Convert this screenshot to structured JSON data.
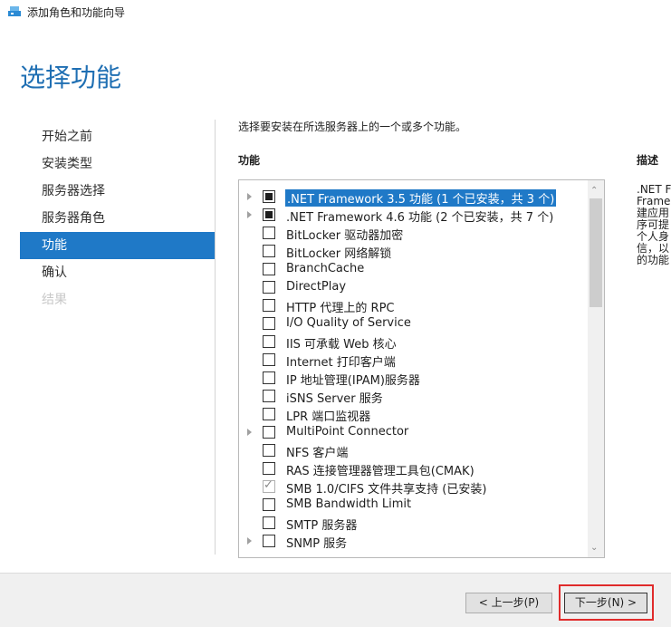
{
  "window": {
    "title": "添加角色和功能向导",
    "icon": "server-manager-icon"
  },
  "page_title": "选择功能",
  "nav": [
    {
      "label": "开始之前",
      "state": "normal"
    },
    {
      "label": "安装类型",
      "state": "normal"
    },
    {
      "label": "服务器选择",
      "state": "normal"
    },
    {
      "label": "服务器角色",
      "state": "normal"
    },
    {
      "label": "功能",
      "state": "active"
    },
    {
      "label": "确认",
      "state": "normal"
    },
    {
      "label": "结果",
      "state": "disabled"
    }
  ],
  "instruction": "选择要安装在所选服务器上的一个或多个功能。",
  "features_label": "功能",
  "description_label": "描述",
  "description_text": ".NET F\nFrame\n建应用\n序可提\n个人身\n信，以\n的功能",
  "features": [
    {
      "label": ".NET Framework 3.5 功能 (1 个已安装，共 3 个)",
      "expandable": true,
      "state": "partial",
      "selected": true
    },
    {
      "label": ".NET Framework 4.6 功能 (2 个已安装，共 7 个)",
      "expandable": true,
      "state": "partial",
      "selected": false
    },
    {
      "label": "BitLocker 驱动器加密",
      "expandable": false,
      "state": "unchecked",
      "selected": false
    },
    {
      "label": "BitLocker 网络解锁",
      "expandable": false,
      "state": "unchecked",
      "selected": false
    },
    {
      "label": "BranchCache",
      "expandable": false,
      "state": "unchecked",
      "selected": false
    },
    {
      "label": "DirectPlay",
      "expandable": false,
      "state": "unchecked",
      "selected": false
    },
    {
      "label": "HTTP 代理上的 RPC",
      "expandable": false,
      "state": "unchecked",
      "selected": false
    },
    {
      "label": "I/O Quality of Service",
      "expandable": false,
      "state": "unchecked",
      "selected": false
    },
    {
      "label": "IIS 可承载 Web 核心",
      "expandable": false,
      "state": "unchecked",
      "selected": false
    },
    {
      "label": "Internet 打印客户端",
      "expandable": false,
      "state": "unchecked",
      "selected": false
    },
    {
      "label": "IP 地址管理(IPAM)服务器",
      "expandable": false,
      "state": "unchecked",
      "selected": false
    },
    {
      "label": "iSNS Server 服务",
      "expandable": false,
      "state": "unchecked",
      "selected": false
    },
    {
      "label": "LPR 端口监视器",
      "expandable": false,
      "state": "unchecked",
      "selected": false
    },
    {
      "label": "MultiPoint Connector",
      "expandable": true,
      "state": "unchecked",
      "selected": false
    },
    {
      "label": "NFS 客户端",
      "expandable": false,
      "state": "unchecked",
      "selected": false
    },
    {
      "label": "RAS 连接管理器管理工具包(CMAK)",
      "expandable": false,
      "state": "unchecked",
      "selected": false
    },
    {
      "label": "SMB 1.0/CIFS 文件共享支持 (已安装)",
      "expandable": false,
      "state": "checked",
      "selected": false
    },
    {
      "label": "SMB Bandwidth Limit",
      "expandable": false,
      "state": "unchecked",
      "selected": false
    },
    {
      "label": "SMTP 服务器",
      "expandable": false,
      "state": "unchecked",
      "selected": false
    },
    {
      "label": "SNMP 服务",
      "expandable": true,
      "state": "unchecked",
      "selected": false
    }
  ],
  "scrollbar": {
    "up_glyph": "⌃",
    "down_glyph": "⌄"
  },
  "buttons": {
    "prev": "< 上一步(P)",
    "next": "下一步(N) >"
  }
}
